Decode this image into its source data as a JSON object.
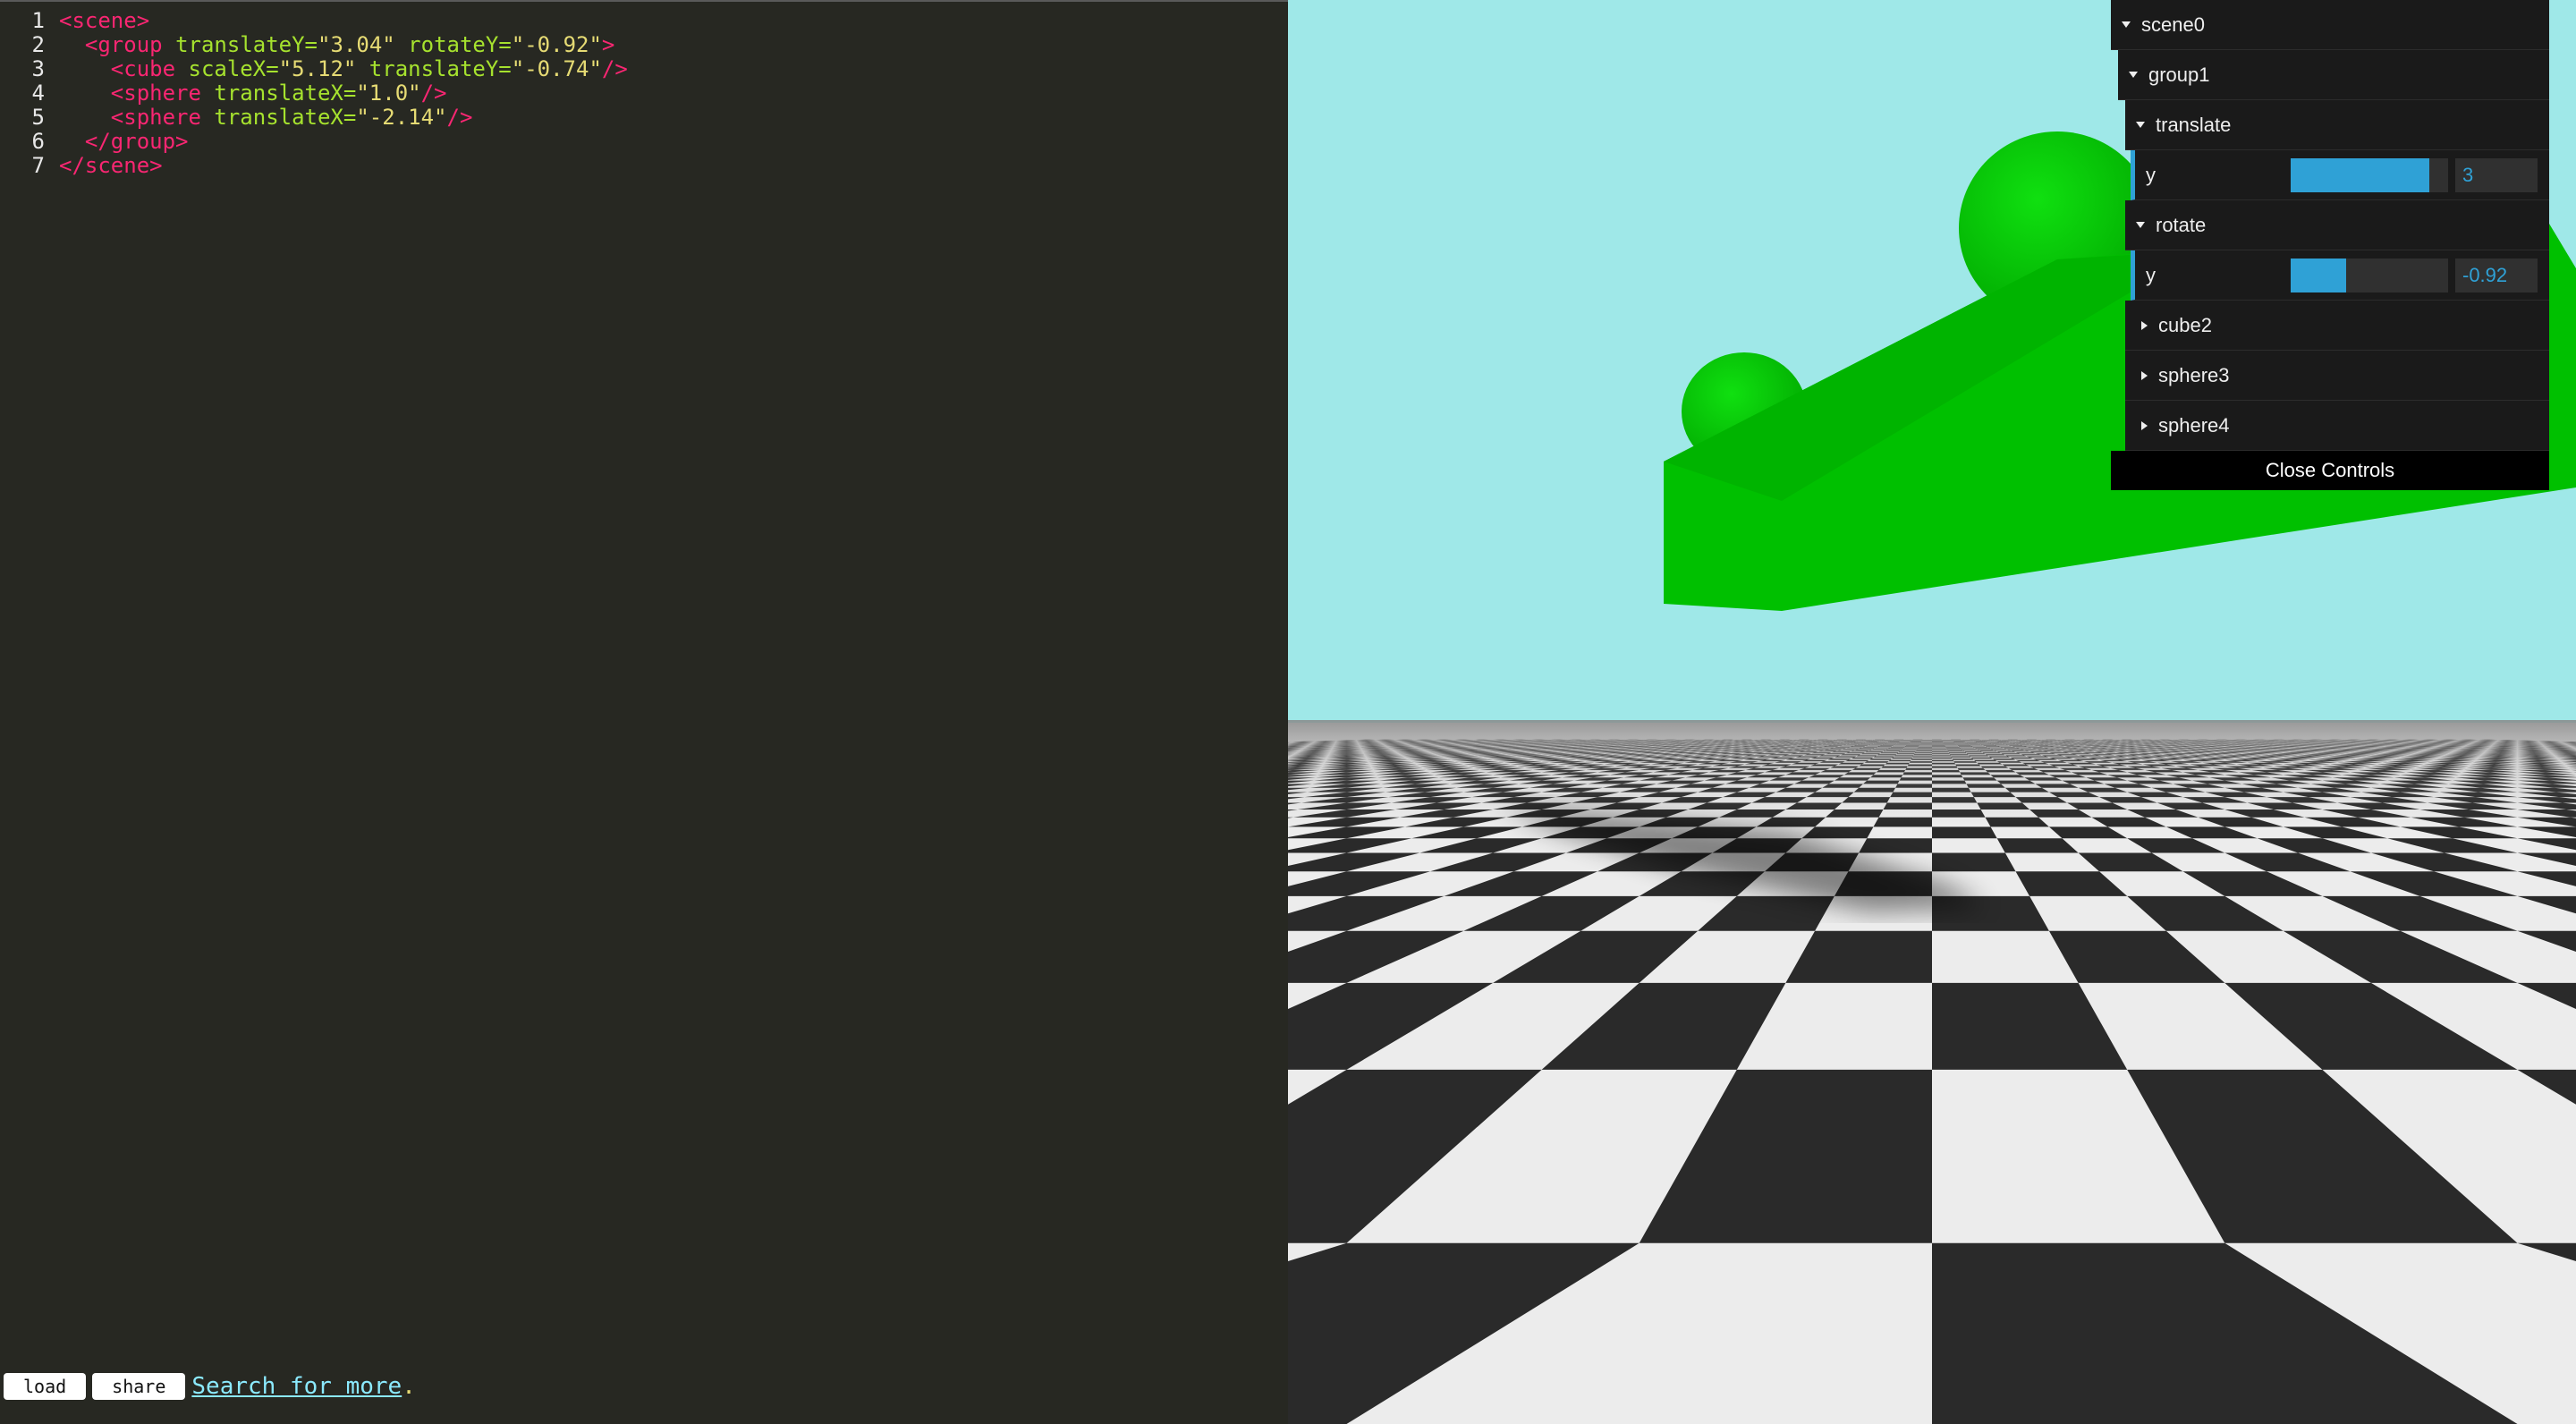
{
  "editor": {
    "lines": [
      {
        "num": "1",
        "parts": [
          {
            "t": "tag",
            "v": "<scene>"
          }
        ]
      },
      {
        "num": "2",
        "parts": [
          {
            "t": "src",
            "v": "  "
          },
          {
            "t": "tag",
            "v": "<group "
          },
          {
            "t": "attr",
            "v": "translateY="
          },
          {
            "t": "str",
            "v": "\"3.04\""
          },
          {
            "t": "attr",
            "v": " rotateY="
          },
          {
            "t": "str",
            "v": "\"-0.92\""
          },
          {
            "t": "tag",
            "v": ">"
          }
        ]
      },
      {
        "num": "3",
        "parts": [
          {
            "t": "src",
            "v": "    "
          },
          {
            "t": "tag",
            "v": "<cube "
          },
          {
            "t": "attr",
            "v": "scaleX="
          },
          {
            "t": "str",
            "v": "\"5.12\""
          },
          {
            "t": "attr",
            "v": " translateY="
          },
          {
            "t": "str",
            "v": "\"-0.74\""
          },
          {
            "t": "tag",
            "v": "/>"
          }
        ]
      },
      {
        "num": "4",
        "parts": [
          {
            "t": "src",
            "v": "    "
          },
          {
            "t": "tag",
            "v": "<sphere "
          },
          {
            "t": "attr",
            "v": "translateX="
          },
          {
            "t": "str",
            "v": "\"1.0\""
          },
          {
            "t": "tag",
            "v": "/>"
          }
        ]
      },
      {
        "num": "5",
        "parts": [
          {
            "t": "src",
            "v": "    "
          },
          {
            "t": "tag",
            "v": "<sphere "
          },
          {
            "t": "attr",
            "v": "translateX="
          },
          {
            "t": "str",
            "v": "\"-2.14\""
          },
          {
            "t": "tag",
            "v": "/>"
          }
        ]
      },
      {
        "num": "6",
        "parts": [
          {
            "t": "src",
            "v": "  "
          },
          {
            "t": "tag",
            "v": "</group>"
          }
        ]
      },
      {
        "num": "7",
        "parts": [
          {
            "t": "tag",
            "v": "</scene>"
          }
        ]
      }
    ],
    "load_label": "load",
    "share_label": "share",
    "search_label": "Search for more",
    "search_dot": "."
  },
  "gui": {
    "scene_label": "scene0",
    "group_label": "group1",
    "translate_label": "translate",
    "translate_y_label": "y",
    "translate_y_value": "3",
    "translate_y_fraction": 0.88,
    "rotate_label": "rotate",
    "rotate_y_label": "y",
    "rotate_y_value": "-0.92",
    "rotate_y_fraction": 0.35,
    "cube_label": "cube2",
    "sphere3_label": "sphere3",
    "sphere4_label": "sphere4",
    "close_label": "Close Controls",
    "accent": "#2fa1d6"
  },
  "scene_colors": {
    "sky": "#9fe8e8",
    "object": "#00c000",
    "floor_light": "#ececec",
    "floor_dark": "#2a2a2a"
  }
}
